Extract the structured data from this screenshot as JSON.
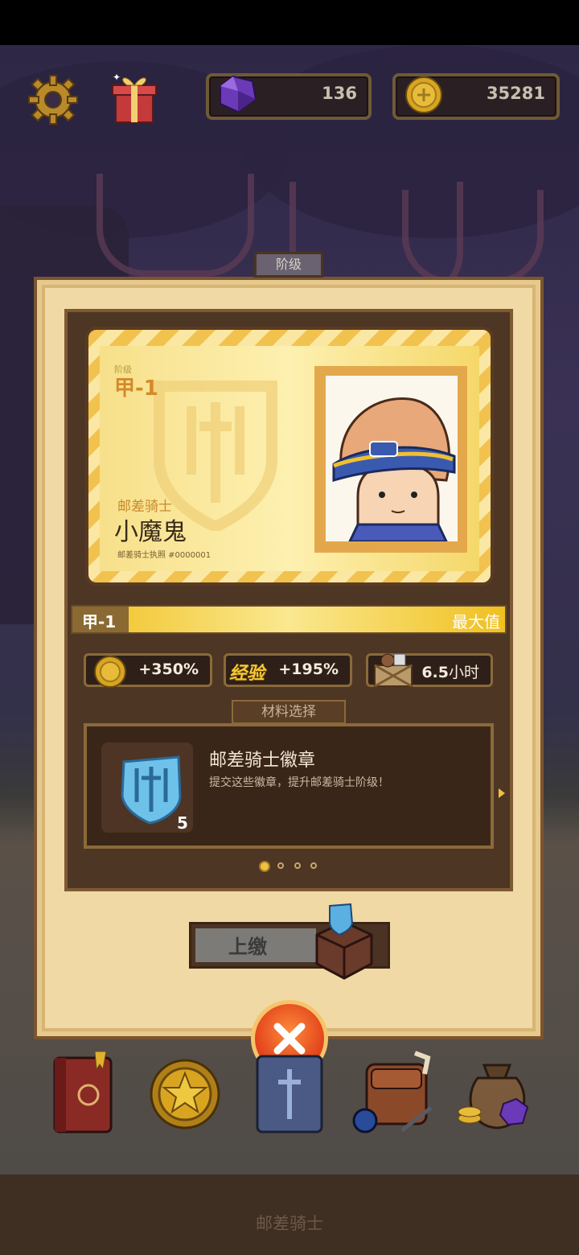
{
  "hud": {
    "gems": "136",
    "coins": "35281"
  },
  "panel": {
    "tab_label": "阶级",
    "card": {
      "grade_small": "阶级",
      "grade": "甲-1",
      "class_label": "邮差骑士",
      "name": "小魔鬼",
      "license": "邮差骑士执照 #0000001"
    },
    "level": {
      "current": "甲-1",
      "max_label": "最大值",
      "progress_fraction": 1.0
    },
    "stats": [
      {
        "icon": "coin-icon",
        "value": "+350%"
      },
      {
        "icon": "exp-icon",
        "label": "经验",
        "value": "+195%"
      },
      {
        "icon": "crate-icon",
        "value": "6.5",
        "unit": "小时"
      }
    ],
    "material_tab": "材料选择",
    "material": {
      "name": "邮差骑士徽章",
      "description": "提交这些徽章，提升邮差骑士阶级！",
      "count": "5"
    },
    "submit_label": "上缴"
  },
  "bottom_title": "邮差骑士",
  "colors": {
    "panel_bg": "#f0d9a4",
    "inner_bg": "#4e3624",
    "accent_gold": "#f0c020",
    "close_red": "#e0401a"
  }
}
